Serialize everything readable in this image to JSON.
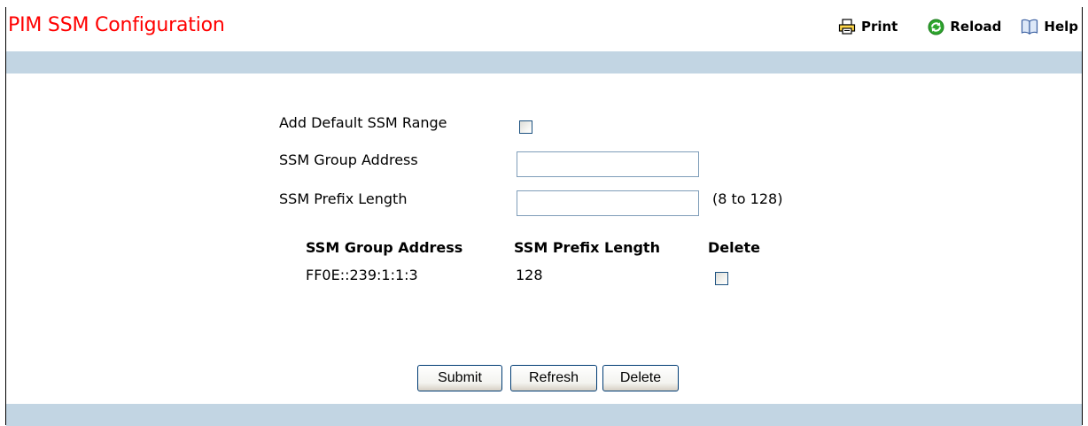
{
  "page": {
    "title": "PIM SSM Configuration"
  },
  "toolbar": {
    "print_label": "Print",
    "reload_label": "Reload",
    "help_label": "Help",
    "print_icon": "printer-icon",
    "reload_icon": "reload-icon",
    "help_icon": "book-icon"
  },
  "form": {
    "add_default_label": "Add Default SSM Range",
    "add_default_checked": false,
    "group_address_label": "SSM Group Address",
    "group_address_value": "",
    "prefix_length_label": "SSM Prefix Length",
    "prefix_length_value": "",
    "prefix_length_range": "(8 to 128)"
  },
  "table": {
    "headers": [
      "SSM Group Address",
      "SSM Prefix Length",
      "Delete"
    ],
    "rows": [
      {
        "group_address": "FF0E::239:1:1:3",
        "prefix_length": "128",
        "delete_checked": false
      }
    ]
  },
  "buttons": {
    "submit": "Submit",
    "refresh": "Refresh",
    "delete": "Delete"
  },
  "colors": {
    "title": "#ff0000",
    "band": "#c2d5e3",
    "reload_icon": "#2ea62e"
  }
}
